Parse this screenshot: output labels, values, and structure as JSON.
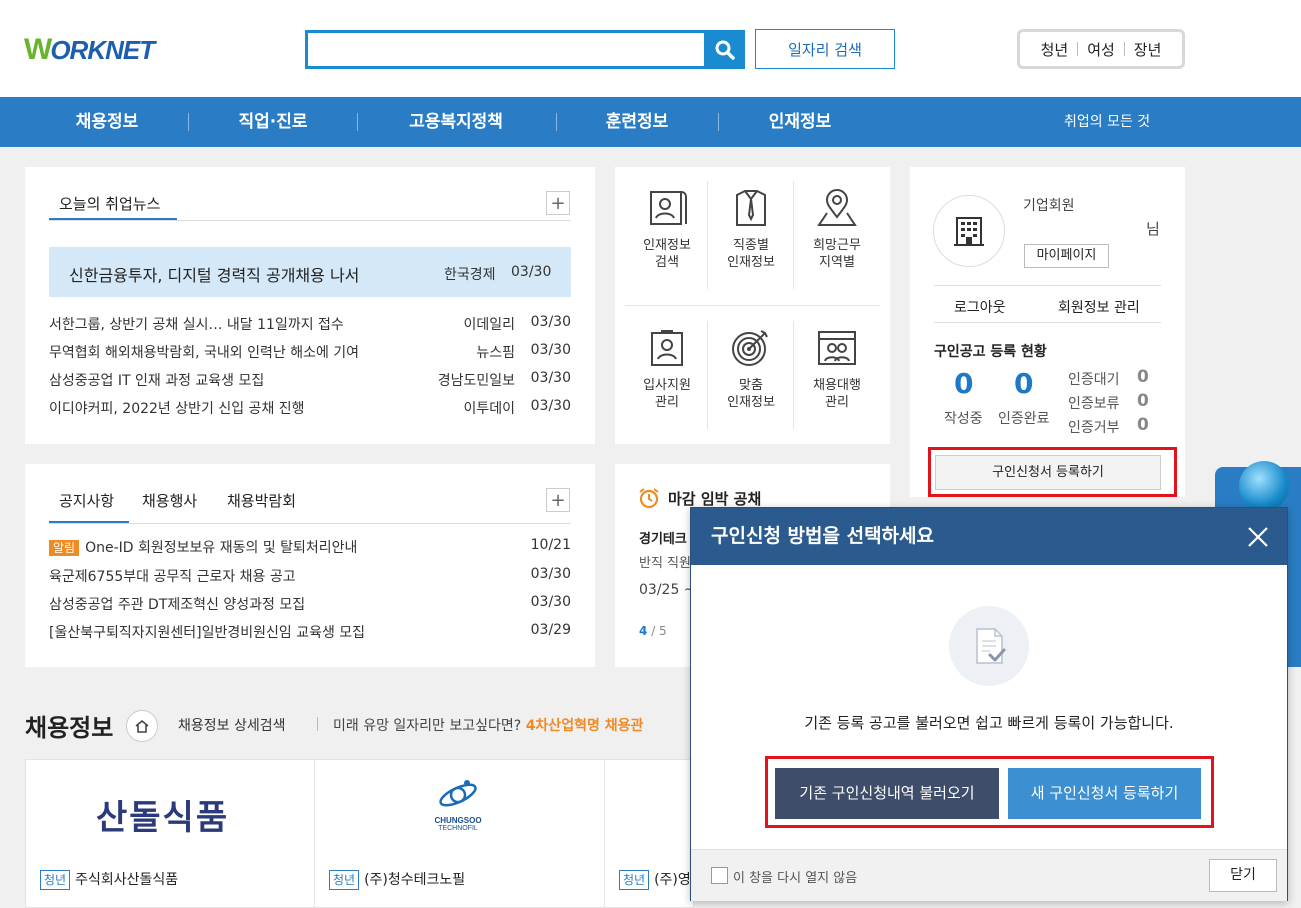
{
  "header": {
    "logo_w": "W",
    "logo_rest": "ORKNET",
    "search_placeholder": "",
    "job_search_label": "일자리 검색",
    "target_tabs": [
      "청년",
      "여성",
      "장년"
    ]
  },
  "nav": {
    "items": [
      "채용정보",
      "직업·진로",
      "고용복지정책",
      "훈련정보",
      "인재정보"
    ],
    "all_label": "취업의 모든 것"
  },
  "news": {
    "tab_label": "오늘의 취업뉴스",
    "featured": {
      "title": "신한금융투자, 디지털 경력직 공개채용 나서",
      "source": "한국경제",
      "date": "03/30"
    },
    "items": [
      {
        "title": "서한그룹, 상반기 공채 실시… 내달 11일까지 접수",
        "source": "이데일리",
        "date": "03/30"
      },
      {
        "title": "무역협회 해외채용박람회, 국내외 인력난 해소에 기여",
        "source": "뉴스핌",
        "date": "03/30"
      },
      {
        "title": "삼성중공업 IT 인재 과정 교육생 모집",
        "source": "경남도민일보",
        "date": "03/30"
      },
      {
        "title": "이디야커피, 2022년 상반기 신입 공채 진행",
        "source": "이투데이",
        "date": "03/30"
      }
    ]
  },
  "quick_menu": [
    {
      "line1": "인재정보",
      "line2": "검색",
      "icon": "document-person-icon"
    },
    {
      "line1": "직종별",
      "line2": "인재정보",
      "icon": "shirt-tie-icon"
    },
    {
      "line1": "희망근무",
      "line2": "지역별",
      "icon": "map-pin-icon"
    },
    {
      "line1": "입사지원",
      "line2": "관리",
      "icon": "id-card-icon"
    },
    {
      "line1": "맞춤",
      "line2": "인재정보",
      "icon": "target-icon"
    },
    {
      "line1": "채용대행",
      "line2": "관리",
      "icon": "browser-people-icon"
    }
  ],
  "member": {
    "type": "기업회원",
    "suffix": "님",
    "mypage_label": "마이페이지",
    "logout_label": "로그아웃",
    "info_label": "회원정보 관리",
    "status_title": "구인공고 등록 현황",
    "writing_count": "0",
    "writing_label": "작성중",
    "certified_count": "0",
    "certified_label": "인증완료",
    "wait_label": "인증대기",
    "wait_count": "0",
    "hold_label": "인증보류",
    "hold_count": "0",
    "reject_label": "인증거부",
    "reject_count": "0",
    "register_label": "구인신청서 등록하기"
  },
  "notice": {
    "tabs": [
      "공지사항",
      "채용행사",
      "채용박람회"
    ],
    "alert_badge": "알림",
    "items": [
      {
        "title": "One-ID 회원정보보유 재동의 및 탈퇴처리안내",
        "date": "10/21"
      },
      {
        "title": "육군제6755부대 공무직 근로자 채용 공고",
        "date": "03/30"
      },
      {
        "title": "삼성중공업 주관 DT제조혁신 양성과정 모집",
        "date": "03/30"
      },
      {
        "title": "[울산북구퇴직자지원센터]일반경비원신임 교육생 모집",
        "date": "03/29"
      }
    ]
  },
  "deadline": {
    "title": "마감 임박 공채",
    "company": "경기테크",
    "desc": "반직 직원",
    "date": "03/25 ~",
    "page_current": "4",
    "page_total": "/ 5"
  },
  "recruit": {
    "title": "채용정보",
    "detail_search": "채용정보 상세검색",
    "promo_text": "미래 유망 일자리만 보고싶다면?",
    "promo_highlight": "4차산업혁명 채용관",
    "cards": [
      {
        "logo_text": "산돌식품",
        "badge": "청년",
        "company": "주식회사산돌식품"
      },
      {
        "logo_text": "CHUNGSOO",
        "logo_sub": "TECHNOFIL",
        "badge": "청년",
        "company": "(주)청수테크노필"
      },
      {
        "logo_text": "",
        "badge": "청년",
        "company": "(주)영"
      }
    ]
  },
  "modal": {
    "title": "구인신청 방법을 선택하세요",
    "message": "기존 등록 공고를 불러오면 쉽고 빠르게 등록이 가능합니다.",
    "load_existing_label": "기존 구인신청내역 불러오기",
    "new_register_label": "새 구인신청서 등록하기",
    "dont_show_label": "이 창을 다시 열지 않음",
    "close_label": "닫기"
  },
  "colors": {
    "nav_blue": "#2a7dc4",
    "modal_header": "#2a5a8e",
    "dark_button": "#3d4d6a",
    "light_button": "#3c8fd1",
    "highlight_red": "#e1141c",
    "featured_bg": "#d4e8f8",
    "orange": "#f08a24"
  }
}
